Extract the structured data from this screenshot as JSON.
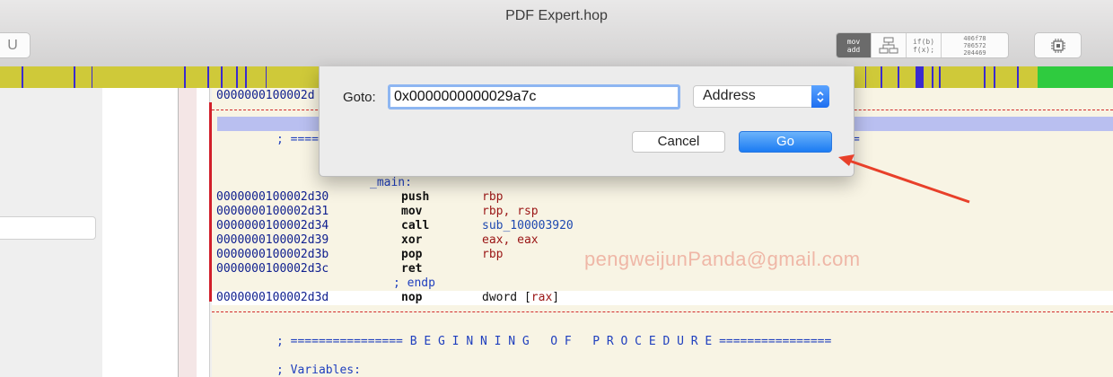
{
  "window": {
    "title": "PDF Expert.hop",
    "left_button_label": "U"
  },
  "toolbar": {
    "asm_mode": {
      "line1": "mov",
      "line2": "add"
    },
    "cfg_icon": "flow-graph-icon",
    "pseudo_mode": {
      "line1": "if(b)",
      "line2": "f(x);"
    },
    "hex_mode": {
      "line1": "406f78",
      "line2": "706572",
      "line3": "204469"
    },
    "cpu_icon": "cpu-chip-icon"
  },
  "colors": {
    "nav_bar": "#cfc939",
    "nav_stripe": "#3a2bd0",
    "nav_green": "#2fcb3f",
    "go_button": "#1b7bf3",
    "annotation_arrow": "#e8402a"
  },
  "dialog": {
    "label": "Goto:",
    "input_value": "0x0000000000029a7c",
    "select_value": "Address",
    "cancel_label": "Cancel",
    "go_label": "Go"
  },
  "code": {
    "top_addr": "0000000100002d",
    "comment_1": "; ====",
    "comment_1_tail": "=",
    "label_main": "_main:",
    "lines": [
      {
        "addr": "0000000100002d30",
        "mnem": "push",
        "op": "rbp"
      },
      {
        "addr": "0000000100002d31",
        "mnem": "mov",
        "op": "rbp, rsp"
      },
      {
        "addr": "0000000100002d34",
        "mnem": "call",
        "op": "sub_100003920"
      },
      {
        "addr": "0000000100002d39",
        "mnem": "xor",
        "op": "eax, eax"
      },
      {
        "addr": "0000000100002d3b",
        "mnem": "pop",
        "op": "rbp"
      },
      {
        "addr": "0000000100002d3c",
        "mnem": "ret",
        "op": ""
      }
    ],
    "endp": "; endp",
    "nop_addr": "0000000100002d3d",
    "nop_mnem": "nop",
    "nop_op_prefix": "dword [",
    "nop_op_reg": "rax",
    "nop_op_suffix": "]",
    "proc_banner": "; ================ B E G I N N I N G   O F   P R O C E D U R E ================",
    "variables": "; Variables:"
  },
  "watermark": "pengweijunPanda@gmail.com"
}
